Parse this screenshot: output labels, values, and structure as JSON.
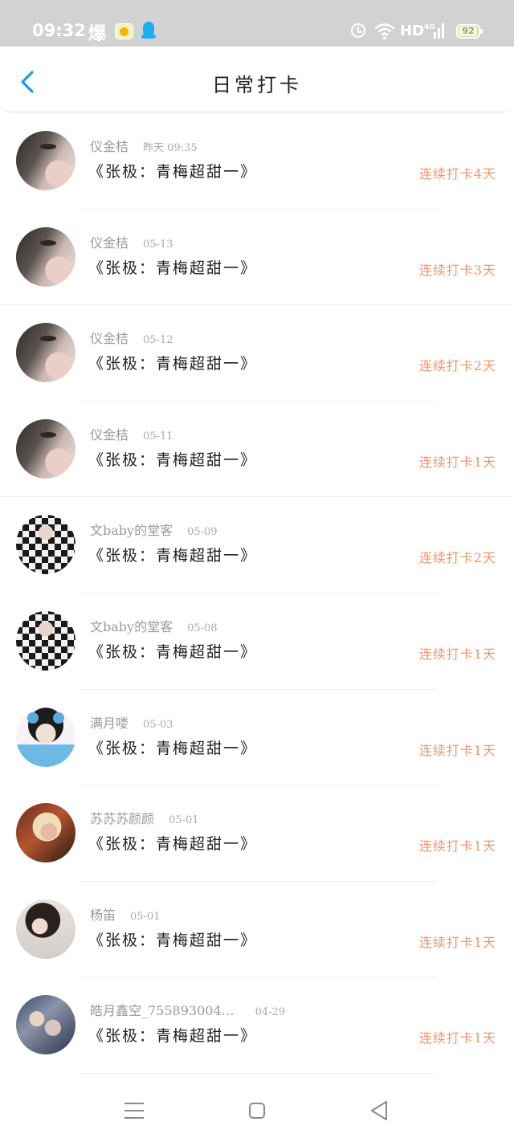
{
  "status_bar": {
    "time": "09:32",
    "fire_label": "爆",
    "network": "HD",
    "signal_label": "4G",
    "battery": "92",
    "icons": [
      "fire-app-icon",
      "notes-app-icon",
      "qq-icon",
      "alarm-icon",
      "wifi-icon",
      "signal-icon",
      "battery-icon"
    ]
  },
  "header": {
    "title": "日常打卡",
    "back_icon": "chevron-left-icon"
  },
  "colors": {
    "accent_blue": "#1a9ae0",
    "streak_orange": "#f0956a",
    "status_bar_bg": "#d2d2d2"
  },
  "entries": [
    {
      "name": "仪金桔",
      "time": "昨天 09:35",
      "title": "《张极：青梅超甜一》",
      "streak": "连续打卡4天"
    },
    {
      "name": "仪金桔",
      "time": "05-13",
      "title": "《张极：青梅超甜一》",
      "streak": "连续打卡3天"
    },
    {
      "name": "仪金桔",
      "time": "05-12",
      "title": "《张极：青梅超甜一》",
      "streak": "连续打卡2天"
    },
    {
      "name": "仪金桔",
      "time": "05-11",
      "title": "《张极：青梅超甜一》",
      "streak": "连续打卡1天"
    },
    {
      "name": "文baby的堂客",
      "time": "05-09",
      "title": "《张极：青梅超甜一》",
      "streak": "连续打卡2天"
    },
    {
      "name": "文baby的堂客",
      "time": "05-08",
      "title": "《张极：青梅超甜一》",
      "streak": "连续打卡1天"
    },
    {
      "name": "满月喽",
      "time": "05-03",
      "title": "《张极：青梅超甜一》",
      "streak": "连续打卡1天"
    },
    {
      "name": "苏苏苏颜颜",
      "time": "05-01",
      "title": "《张极：青梅超甜一》",
      "streak": "连续打卡1天"
    },
    {
      "name": "杨笛",
      "time": "05-01",
      "title": "《张极：青梅超甜一》",
      "streak": "连续打卡1天"
    },
    {
      "name": "皓月鑫空_755893004…",
      "time": "04-29",
      "title": "《张极：青梅超甜一》",
      "streak": "连续打卡1天"
    }
  ],
  "nav_bar": {
    "icons": [
      "menu-icon",
      "home-icon",
      "back-triangle-icon"
    ]
  }
}
